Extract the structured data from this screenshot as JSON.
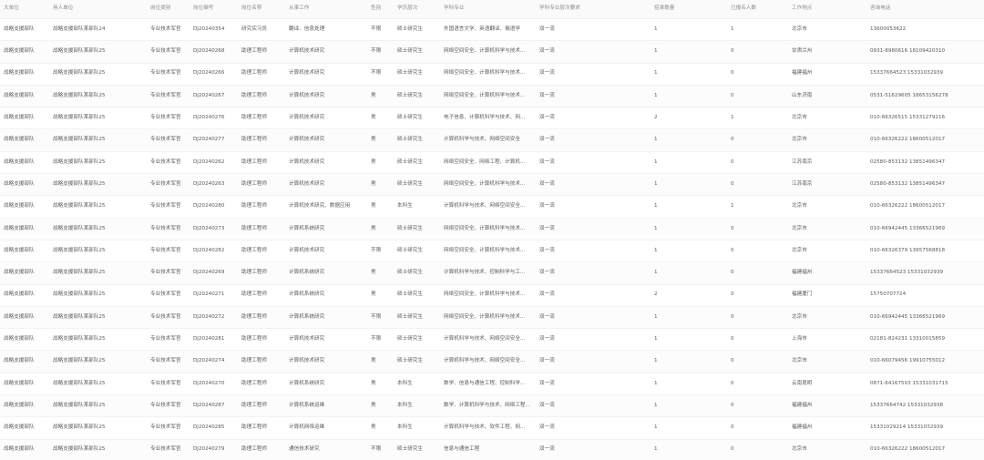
{
  "table": {
    "columns": [
      "大单位",
      "用人单位",
      "岗位类别",
      "岗位编号",
      "岗位名称",
      "从事工作",
      "性别",
      "学历层次",
      "学科专业",
      "学科专业层次要求",
      "招录数量",
      "已报名人数",
      "工作地点",
      "咨询电话"
    ],
    "rows": [
      [
        "战略支援部队",
        "战略支援部队某部队24",
        "专业技术军官",
        "DJ20240354",
        "研究实习员",
        "翻译、信息处理",
        "不限",
        "硕士研究生",
        "外国语言文学、英语翻译、俄语学",
        "双一流",
        "1",
        "1",
        "北京市",
        "13600053622"
      ],
      [
        "战略支援部队",
        "战略支援部队某部队25",
        "专业技术军官",
        "DJ20240268",
        "助理工程师",
        "计算机技术研究",
        "不限",
        "硕士研究生",
        "网络空间安全、计算机科学与技术...",
        "双一流",
        "1",
        "0",
        "甘肃兰州",
        "0931-8980616 18109420310"
      ],
      [
        "战略支援部队",
        "战略支援部队某部队25",
        "专业技术军官",
        "DJ20240266",
        "助理工程师",
        "计算机技术研究",
        "不限",
        "硕士研究生",
        "网络空间安全、计算机科学与技术...",
        "双一流",
        "1",
        "0",
        "福建福州",
        "15337664523 15331032939"
      ],
      [
        "战略支援部队",
        "战略支援部队某部队25",
        "专业技术军官",
        "DJ20240267",
        "助理工程师",
        "计算机技术研究",
        "男",
        "硕士研究生",
        "网络空间安全、计算机科学与技术...",
        "双一流",
        "1",
        "0",
        "山东济南",
        "0531-51629605 18653156278"
      ],
      [
        "战略支援部队",
        "战略支援部队某部队25",
        "专业技术军官",
        "DJ20240276",
        "助理工程师",
        "计算机技术研究",
        "男",
        "硕士研究生",
        "电子信息、计算机科学与技术、网...",
        "双一流",
        "2",
        "1",
        "北京市",
        "010-66326515 15331279216"
      ],
      [
        "战略支援部队",
        "战略支援部队某部队25",
        "专业技术军官",
        "DJ20240277",
        "助理工程师",
        "计算机技术研究",
        "男",
        "硕士研究生",
        "计算机科学与技术、网络空间安全",
        "双一流",
        "1",
        "0",
        "北京市",
        "010-66326222 18600512017"
      ],
      [
        "战略支援部队",
        "战略支援部队某部队25",
        "专业技术军官",
        "DJ20240262",
        "助理工程师",
        "计算机技术研究",
        "男",
        "硕士研究生",
        "网络空间安全、网络工程、计算机...",
        "双一流",
        "1",
        "0",
        "江苏南京",
        "02580-853132 13851496347"
      ],
      [
        "战略支援部队",
        "战略支援部队某部队25",
        "专业技术军官",
        "DJ20240263",
        "助理工程师",
        "计算机技术研究",
        "男",
        "硕士研究生",
        "网络空间安全、计算机科学与技术...",
        "双一流",
        "1",
        "0",
        "江苏南京",
        "02580-853132 13851496347"
      ],
      [
        "战略支援部队",
        "战略支援部队某部队25",
        "专业技术军官",
        "DJ20240280",
        "助理工程师",
        "计算机技术研究、数据应用",
        "男",
        "本科生",
        "计算机科学与技术、网络空间安全...",
        "双一流",
        "1",
        "1",
        "北京市",
        "010-66326222 18600512017"
      ],
      [
        "战略支援部队",
        "战略支援部队某部队25",
        "专业技术军官",
        "DJ20240273",
        "助理工程师",
        "计算机系统研究",
        "男",
        "硕士研究生",
        "网络空间安全、计算机科学与技术...",
        "双一流",
        "1",
        "0",
        "北京市",
        "010-66942445 13366521969"
      ],
      [
        "战略支援部队",
        "战略支援部队某部队25",
        "专业技术军官",
        "DJ20240282",
        "助理工程师",
        "计算机技术研究",
        "不限",
        "硕士研究生",
        "网络空间安全、计算机科学与技术...",
        "双一流",
        "1",
        "0",
        "北京市",
        "010-66326379 13957568818"
      ],
      [
        "战略支援部队",
        "战略支援部队某部队25",
        "专业技术军官",
        "DJ20240269",
        "助理工程师",
        "计算机系统研究",
        "男",
        "硕士研究生",
        "计算机科学与技术、控制科学与工...",
        "双一流",
        "1",
        "0",
        "福建福州",
        "15337664523 15331032939"
      ],
      [
        "战略支援部队",
        "战略支援部队某部队25",
        "专业技术军官",
        "DJ20240271",
        "助理工程师",
        "计算机系统研究",
        "男",
        "硕士研究生",
        "网络空间安全、计算机科学与技术...",
        "双一流",
        "2",
        "0",
        "福建厦门",
        "15750707724"
      ],
      [
        "战略支援部队",
        "战略支援部队某部队25",
        "专业技术军官",
        "DJ20240272",
        "助理工程师",
        "计算机系统研究",
        "不限",
        "硕士研究生",
        "网络空间安全、计算机科学与技术...",
        "双一流",
        "1",
        "0",
        "北京市",
        "010-66942445 13366521969"
      ],
      [
        "战略支援部队",
        "战略支援部队某部队25",
        "专业技术军官",
        "DJ20240281",
        "助理工程师",
        "计算机技术研究",
        "不限",
        "硕士研究生",
        "计算机科学与技术、网络空间安全...",
        "双一流",
        "1",
        "0",
        "上海市",
        "02181-824231 13310015859"
      ],
      [
        "战略支援部队",
        "战略支援部队某部队25",
        "专业技术军官",
        "DJ20240274",
        "助理工程师",
        "计算机技术研究",
        "男",
        "硕士研究生",
        "计算机科学与技术、网络空间安全...",
        "双一流",
        "1",
        "0",
        "北京市",
        "010-66079456 19910755012"
      ],
      [
        "战略支援部队",
        "战略支援部队某部队25",
        "专业技术军官",
        "DJ20240270",
        "助理工程师",
        "计算机系统研究",
        "男",
        "本科生",
        "数学、信息与通信工程、控制科学...",
        "双一流",
        "1",
        "0",
        "云南昆明",
        "0871-64167503 15331031715"
      ],
      [
        "战略支援部队",
        "战略支援部队某部队25",
        "专业技术军官",
        "DJ20240287",
        "助理工程师",
        "计算机系统运维",
        "男",
        "本科生",
        "数学、计算机科学与技术、网络工程...",
        "双一流",
        "1",
        "0",
        "福建福州",
        "15337664742 15331032938"
      ],
      [
        "战略支援部队",
        "战略支援部队某部队25",
        "专业技术军官",
        "DJ20240285",
        "助理工程师",
        "计算机网络运维",
        "男",
        "本科生",
        "计算机科学与技术、软件工程、网...",
        "双一流",
        "1",
        "0",
        "福建福州",
        "15331029214 15331032939"
      ],
      [
        "战略支援部队",
        "战略支援部队某部队25",
        "专业技术军官",
        "DJ20240279",
        "助理工程师",
        "通信技术研究",
        "不限",
        "硕士研究生",
        "信息与通信工程",
        "双一流",
        "1",
        "0",
        "北京市",
        "010-66326222 18600512017"
      ]
    ]
  }
}
